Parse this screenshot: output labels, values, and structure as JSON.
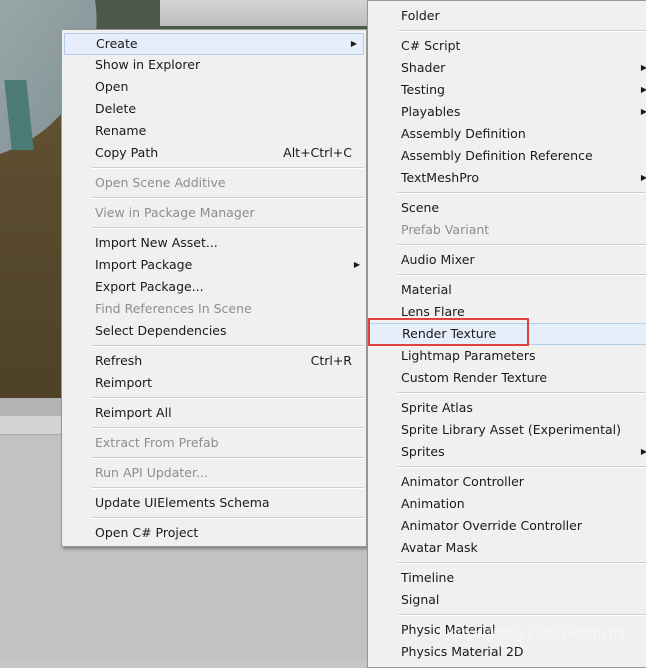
{
  "context_menu": {
    "items": [
      {
        "label": "Create",
        "submenu": true
      },
      {
        "label": "Show in Explorer"
      },
      {
        "label": "Open"
      },
      {
        "label": "Delete"
      },
      {
        "label": "Rename"
      },
      {
        "label": "Copy Path",
        "shortcut": "Alt+Ctrl+C"
      },
      {
        "label": "Open Scene Additive",
        "disabled": true
      },
      {
        "label": "View in Package Manager",
        "disabled": true
      },
      {
        "label": "Import New Asset..."
      },
      {
        "label": "Import Package",
        "submenu": true
      },
      {
        "label": "Export Package..."
      },
      {
        "label": "Find References In Scene",
        "disabled": true
      },
      {
        "label": "Select Dependencies"
      },
      {
        "label": "Refresh",
        "shortcut": "Ctrl+R"
      },
      {
        "label": "Reimport"
      },
      {
        "label": "Reimport All"
      },
      {
        "label": "Extract From Prefab",
        "disabled": true
      },
      {
        "label": "Run API Updater...",
        "disabled": true
      },
      {
        "label": "Update UIElements Schema"
      },
      {
        "label": "Open C# Project"
      }
    ]
  },
  "create_submenu": {
    "items": [
      {
        "label": "Folder"
      },
      {
        "label": "C# Script"
      },
      {
        "label": "Shader",
        "submenu": true
      },
      {
        "label": "Testing",
        "submenu": true
      },
      {
        "label": "Playables",
        "submenu": true
      },
      {
        "label": "Assembly Definition"
      },
      {
        "label": "Assembly Definition Reference"
      },
      {
        "label": "TextMeshPro",
        "submenu": true
      },
      {
        "label": "Scene"
      },
      {
        "label": "Prefab Variant",
        "disabled": true
      },
      {
        "label": "Audio Mixer"
      },
      {
        "label": "Material"
      },
      {
        "label": "Lens Flare"
      },
      {
        "label": "Render Texture",
        "highlighted": true
      },
      {
        "label": "Lightmap Parameters"
      },
      {
        "label": "Custom Render Texture"
      },
      {
        "label": "Sprite Atlas"
      },
      {
        "label": "Sprite Library Asset (Experimental)"
      },
      {
        "label": "Sprites",
        "submenu": true
      },
      {
        "label": "Animator Controller"
      },
      {
        "label": "Animation"
      },
      {
        "label": "Animator Override Controller"
      },
      {
        "label": "Avatar Mask"
      },
      {
        "label": "Timeline"
      },
      {
        "label": "Signal"
      },
      {
        "label": "Physic Material"
      },
      {
        "label": "Physics Material 2D"
      }
    ]
  },
  "submenu_arrow": "▶",
  "watermark": "https://blog.csdn.net/mythl",
  "colors": {
    "highlight": "#e6eefb",
    "annotation_box": "#e04040",
    "disabled_text": "#8d8d8d"
  }
}
